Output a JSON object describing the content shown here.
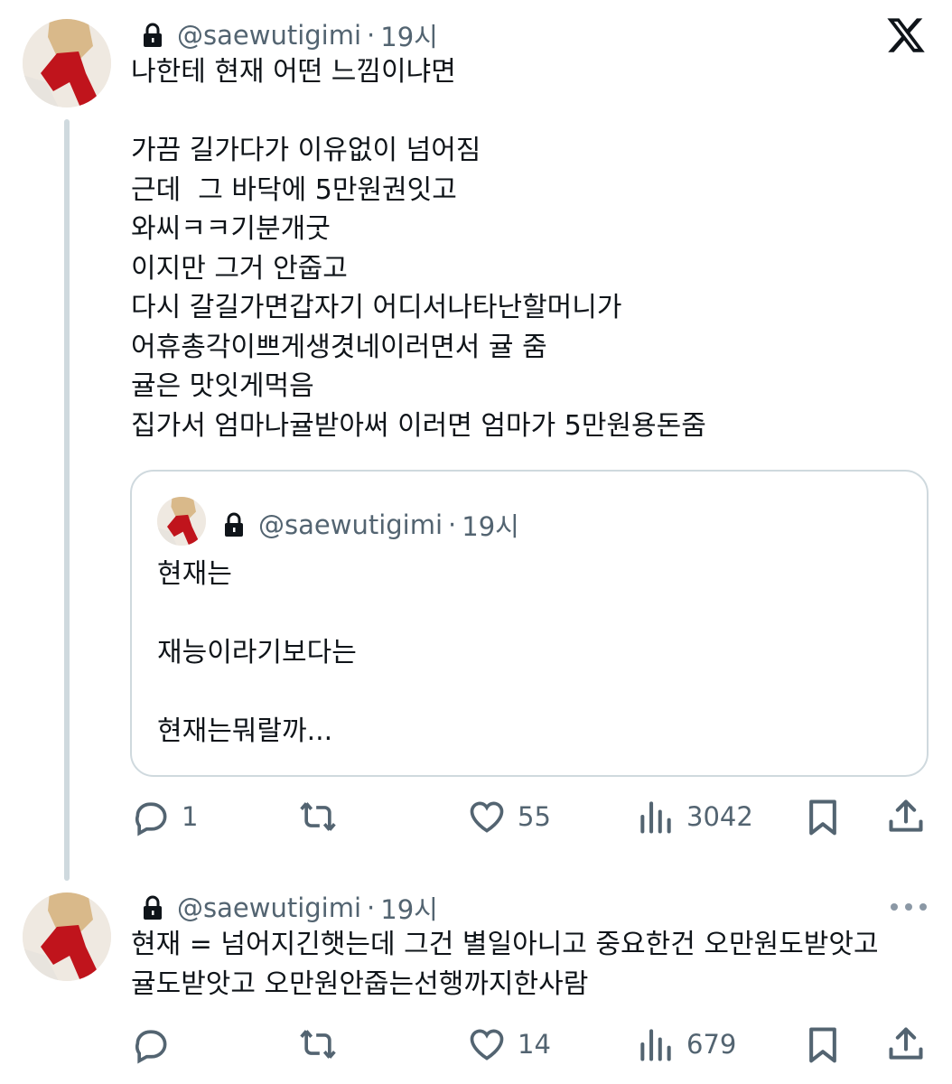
{
  "tweet1": {
    "handle": "@saewutigimi",
    "separator": "·",
    "time": "19시",
    "text": "나한테 현재 어떤 느낌이냐면\n\n가끔 길가다가 이유없이 넘어짐\n근데  그 바닥에 5만원권잇고\n와씨ㅋㅋ기분개굿\n이지만 그거 안줍고\n다시 갈길가면갑자기 어디서나타난할머니가\n어휴총각이쁘게생겻네이러면서 귤 줌\n귤은 맛잇게먹음\n집가서 엄마나귤받아써 이러면 엄마가 5만원용돈줌",
    "quote": {
      "handle": "@saewutigimi",
      "separator": "·",
      "time": "19시",
      "text": "현재는\n\n재능이라기보다는\n\n현재는뭐랄까..."
    },
    "actions": {
      "replies": "1",
      "retweets": "",
      "likes": "55",
      "views": "3042"
    }
  },
  "tweet2": {
    "handle": "@saewutigimi",
    "separator": "·",
    "time": "19시",
    "text": "현재 = 넘어지긴햇는데 그건 별일아니고 중요한건 오만원도받앗고\n귤도받앗고 오만원안줍는선행까지한사람",
    "actions": {
      "replies": "",
      "retweets": "",
      "likes": "14",
      "views": "679"
    }
  },
  "icons": {
    "logo": "x-logo-icon",
    "lock": "lock-icon",
    "reply": "reply-icon",
    "retweet": "retweet-icon",
    "like": "heart-icon",
    "views": "views-icon",
    "bookmark": "bookmark-icon",
    "share": "share-icon",
    "more": "more-icon"
  },
  "colors": {
    "text": "#0f1419",
    "secondary": "#536471",
    "border": "#cfd9de",
    "avatar_red": "#c0141c"
  }
}
